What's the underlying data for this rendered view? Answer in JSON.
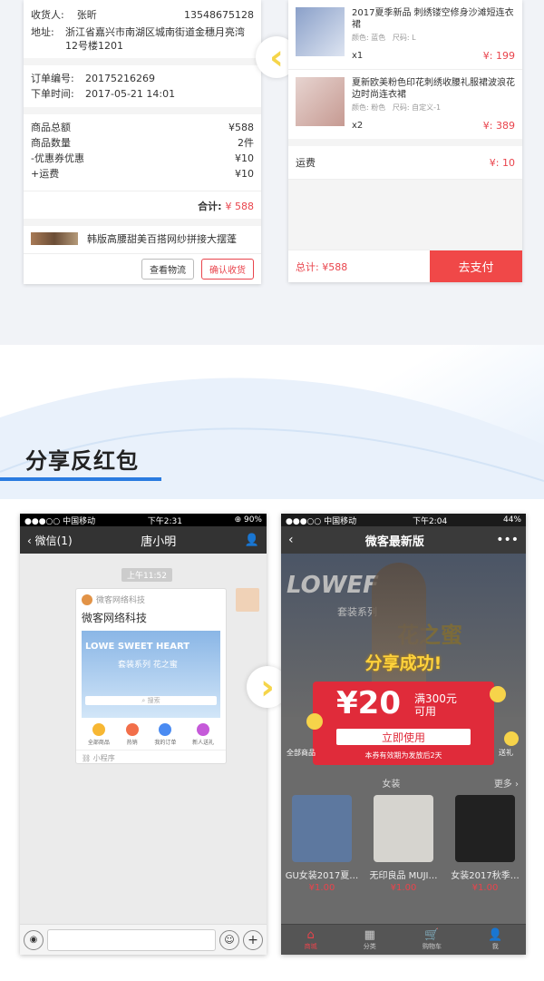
{
  "order": {
    "consignee_label": "收货人:",
    "consignee_name": "张昕",
    "phone": "13548675128",
    "address_label": "地址:",
    "address": "浙江省嘉兴市南湖区城南街道金穗月亮湾12号楼1201",
    "order_no_label": "订单编号:",
    "order_no": "20175216269",
    "order_time_label": "下单时间:",
    "order_time": "2017-05-21  14:01",
    "summary": [
      {
        "label": "商品总额",
        "value": "¥588"
      },
      {
        "label": "商品数量",
        "value": "2件"
      },
      {
        "label": "-优惠券优惠",
        "value": "¥10"
      },
      {
        "label": "+运费",
        "value": "¥10"
      }
    ],
    "total_label": "合计:",
    "total_value": "¥ 588",
    "product_title": "韩版高腰甜美百搭网纱拼接大摆蓬",
    "btn_logistics": "查看物流",
    "btn_confirm": "确认收货"
  },
  "cart": {
    "items": [
      {
        "title": "2017夏季新品 刺绣镂空修身沙滩短连衣裙",
        "color": "颜色: 蓝色",
        "size": "尺码: L",
        "qty": "x1",
        "price": "¥: 199"
      },
      {
        "title": "夏新欧美粉色印花刺绣收腰礼服裙波浪花边时尚连衣裙",
        "color": "颜色: 粉色",
        "size": "尺码: 自定义-1",
        "qty": "x2",
        "price": "¥: 389"
      }
    ],
    "shipping_label": "运费",
    "shipping_value": "¥: 10",
    "total_label": "总计: ¥588",
    "pay_button": "去支付"
  },
  "section": {
    "title": "分享反红包"
  },
  "wechat": {
    "carrier": "●●●○○ 中国移动",
    "time": "下午2:31",
    "battery": "⊕ 90%",
    "back_label": "微信(1)",
    "chat_title": "唐小明",
    "timestamp": "上午11:52",
    "mini_source": "微客网络科技",
    "mini_title": "微客网络科技",
    "mini_banner_text": "LOWE  SWEET HEART",
    "mini_banner_sub": "套装系列  花之蜜",
    "mini_search": "搜索",
    "mini_nav": [
      "全部商品",
      "热销",
      "我的订单",
      "新人送礼"
    ],
    "mini_footer": "小程序"
  },
  "shop": {
    "carrier": "●●●○○ 中国移动",
    "time": "下午2:04",
    "battery": "44%",
    "title": "微客最新版",
    "banner_text": "LOWEF",
    "banner_sub": "套装系列",
    "banner_cn": "花之蜜",
    "popup_success": "分享成功!",
    "coupon_amount": "¥20",
    "coupon_threshold": "满300元",
    "coupon_usable": "可用",
    "coupon_button": "立即使用",
    "coupon_note": "本券有效期为发放后2天",
    "category_all": "全部商品",
    "category_gift": "送礼",
    "section_label": "女装",
    "more": "更多",
    "products": [
      {
        "name": "GU女装2017夏…",
        "price": "¥1.00"
      },
      {
        "name": "无印良品 MUJI…",
        "price": "¥1.00"
      },
      {
        "name": "女装2017秋季…",
        "price": "¥1.00"
      }
    ],
    "tabs": [
      "商城",
      "分类",
      "购物车",
      "我"
    ]
  }
}
